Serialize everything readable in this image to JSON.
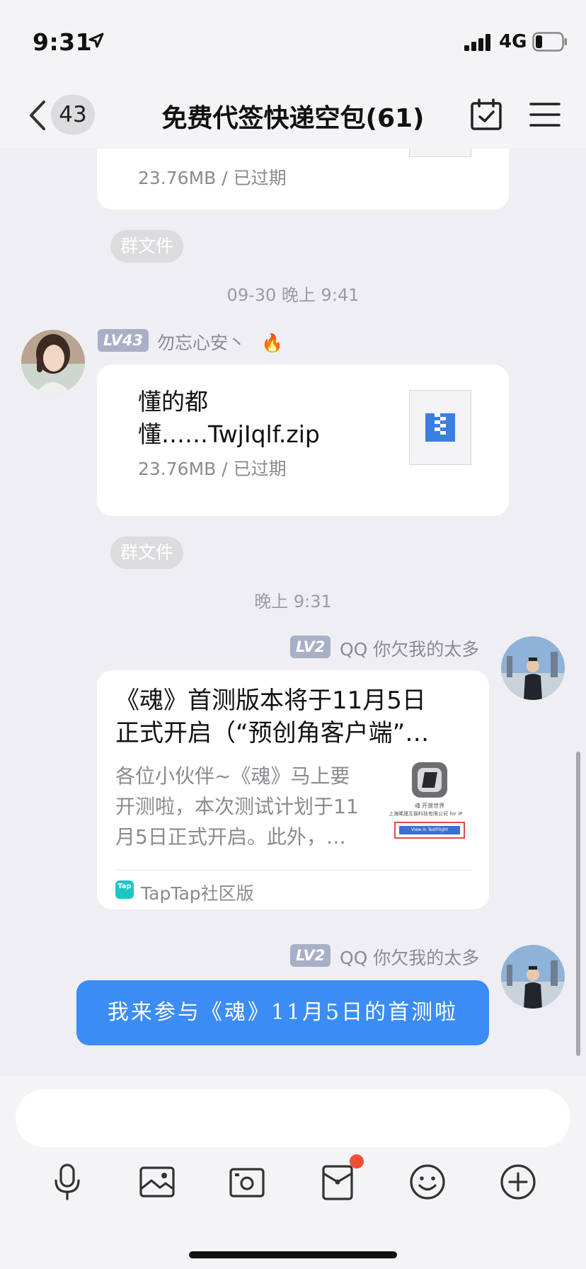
{
  "status_bar": {
    "time": "9:31",
    "network": "4G",
    "icons": [
      "location-arrow-icon",
      "signal-bars-icon",
      "battery-icon"
    ]
  },
  "nav": {
    "unread_count": "43",
    "title": "免费代签快递空包(61)",
    "icons": [
      "back-arrow-icon",
      "calendar-check-icon",
      "menu-icon"
    ]
  },
  "messages": {
    "prev_file": {
      "meta": "23.76MB / 已过期"
    },
    "group_file_label_1": "群文件",
    "timestamp_1": "09-30 晚上 9:41",
    "msg1": {
      "level": "LV43",
      "sender": "勿忘心安丶",
      "sender_emoji": "🔥",
      "file_name_line1": "懂的都",
      "file_name_line2": "懂……TwjIqlf.zip",
      "file_meta": "23.76MB / 已过期",
      "file_icon": "zip-file-icon"
    },
    "group_file_label_2": "群文件",
    "timestamp_2": "晚上 9:31",
    "msg2": {
      "level": "LV2",
      "sender": "QQ 你欠我的太多",
      "link_title_line1": "《魂》首测版本将于11月5日",
      "link_title_line2": "正式开启（“预创角客户端”…",
      "link_desc_line1": "各位小伙伴~《魂》马上要",
      "link_desc_line2": "开测啦，本次测试计划于11",
      "link_desc_line3": "月5日正式开启。此外，…",
      "thumb_text_1": "魂 开放世界",
      "thumb_text_2": "上海晞晟互娱科技有限公司 for iP",
      "thumb_button": "View in TestFlight",
      "source_logo": "Tap",
      "source": "TapTap社区版"
    },
    "msg3": {
      "level": "LV2",
      "sender": "QQ 你欠我的太多",
      "text": "我来参与《魂》11月5日的首测啦"
    }
  },
  "toolbar": {
    "icons": [
      "microphone-icon",
      "image-icon",
      "camera-icon",
      "red-packet-icon",
      "emoji-icon",
      "plus-icon"
    ],
    "accent": "#3b8cf5",
    "badge_color": "#f24e35"
  }
}
